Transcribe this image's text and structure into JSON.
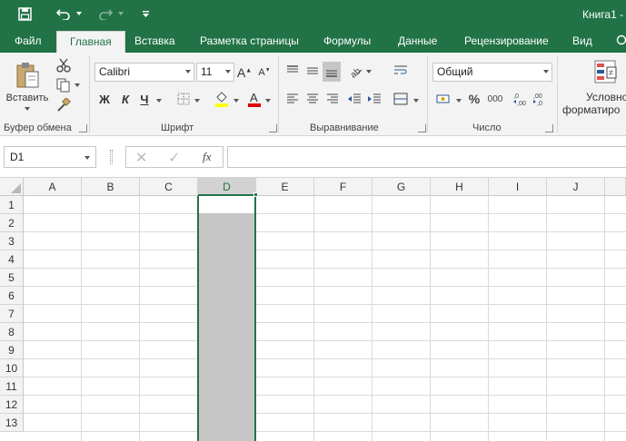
{
  "titlebar": {
    "title": "Книга1 -",
    "icons": [
      "save-icon",
      "undo-icon",
      "redo-icon",
      "customize-qat-icon"
    ]
  },
  "tabs": [
    {
      "label": "Файл",
      "active": false
    },
    {
      "label": "Главная",
      "active": true
    },
    {
      "label": "Вставка",
      "active": false
    },
    {
      "label": "Разметка страницы",
      "active": false
    },
    {
      "label": "Формулы",
      "active": false
    },
    {
      "label": "Данные",
      "active": false
    },
    {
      "label": "Рецензирование",
      "active": false
    },
    {
      "label": "Вид",
      "active": false
    }
  ],
  "ribbon": {
    "clipboard": {
      "paste_label": "Вставить",
      "group_label": "Буфер обмена"
    },
    "font": {
      "name": "Calibri",
      "size": "11",
      "bold": "Ж",
      "italic": "К",
      "underline": "Ч",
      "group_label": "Шрифт"
    },
    "alignment": {
      "group_label": "Выравнивание"
    },
    "number": {
      "format": "Общий",
      "percent": "%",
      "thousands": "000",
      "group_label": "Число"
    },
    "styles": {
      "label_line1": "Условно",
      "label_line2": "форматиро"
    }
  },
  "formula_bar": {
    "name_box": "D1",
    "fx": "fx",
    "value": ""
  },
  "sheet": {
    "columns": [
      "A",
      "B",
      "C",
      "D",
      "E",
      "F",
      "G",
      "H",
      "I",
      "J"
    ],
    "rows": [
      "1",
      "2",
      "3",
      "4",
      "5",
      "6",
      "7",
      "8",
      "9",
      "10",
      "11",
      "12",
      "13"
    ],
    "selected_column": "D",
    "active_cell": "D1"
  },
  "colors": {
    "accent": "#217346",
    "selection": "#c6c6c6"
  }
}
